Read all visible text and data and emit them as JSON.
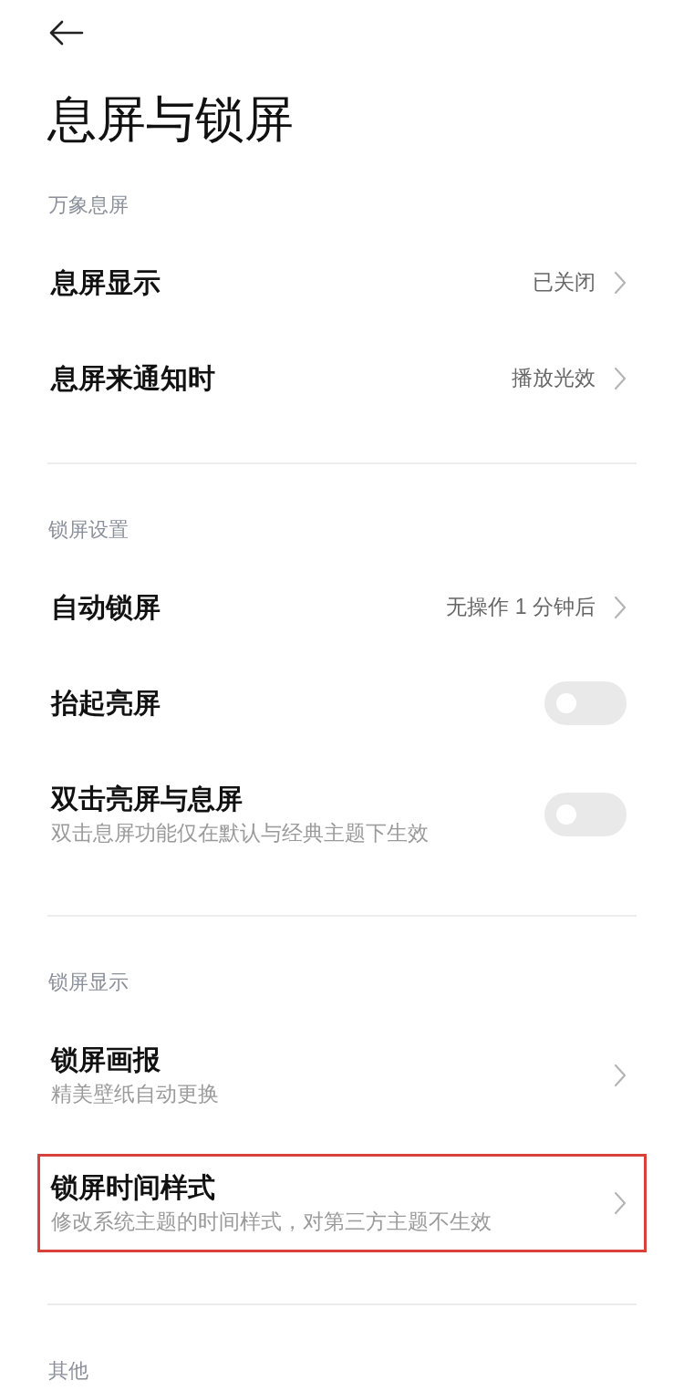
{
  "title": "息屏与锁屏",
  "sections": [
    {
      "header": "万象息屏",
      "items": [
        {
          "kind": "value",
          "title": "息屏显示",
          "value": "已关闭"
        },
        {
          "kind": "value",
          "title": "息屏来通知时",
          "value": "播放光效"
        }
      ]
    },
    {
      "header": "锁屏设置",
      "items": [
        {
          "kind": "value",
          "title": "自动锁屏",
          "value": "无操作 1 分钟后"
        },
        {
          "kind": "toggle",
          "title": "抬起亮屏",
          "on": false
        },
        {
          "kind": "toggle",
          "title": "双击亮屏与息屏",
          "subtitle": "双击息屏功能仅在默认与经典主题下生效",
          "on": false
        }
      ]
    },
    {
      "header": "锁屏显示",
      "items": [
        {
          "kind": "link",
          "title": "锁屏画报",
          "subtitle": "精美壁纸自动更换",
          "highlighted": false
        },
        {
          "kind": "link",
          "title": "锁屏时间样式",
          "subtitle": "修改系统主题的时间样式，对第三方主题不生效",
          "highlighted": true
        }
      ]
    },
    {
      "header": "其他"
    }
  ]
}
